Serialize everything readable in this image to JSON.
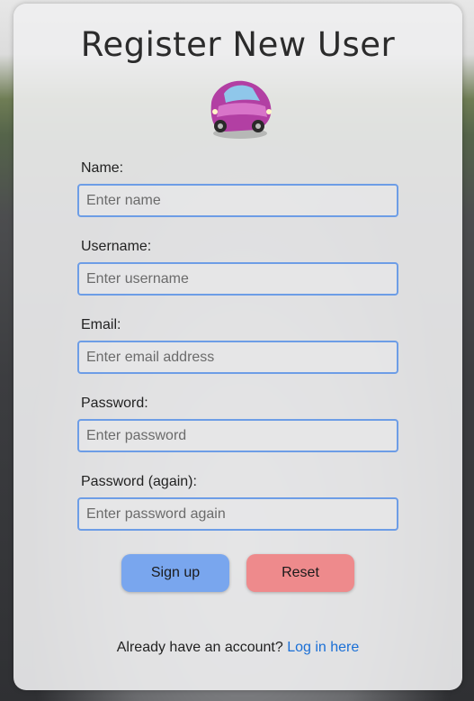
{
  "page": {
    "title": "Register New User",
    "car_icon": "car-icon"
  },
  "form": {
    "fields": [
      {
        "label": "Name:",
        "placeholder": "Enter name"
      },
      {
        "label": "Username:",
        "placeholder": "Enter username"
      },
      {
        "label": "Email:",
        "placeholder": "Enter email address"
      },
      {
        "label": "Password:",
        "placeholder": "Enter password"
      },
      {
        "label": "Password (again):",
        "placeholder": "Enter password again"
      }
    ],
    "signup_label": "Sign up",
    "reset_label": "Reset"
  },
  "footer": {
    "prompt": "Already have an account?",
    "link_text": "Log in here"
  },
  "colors": {
    "input_border": "#6d9de6",
    "signup_button": "#79a6ee",
    "reset_button": "#ee8a8c",
    "link": "#1a6fd6"
  }
}
